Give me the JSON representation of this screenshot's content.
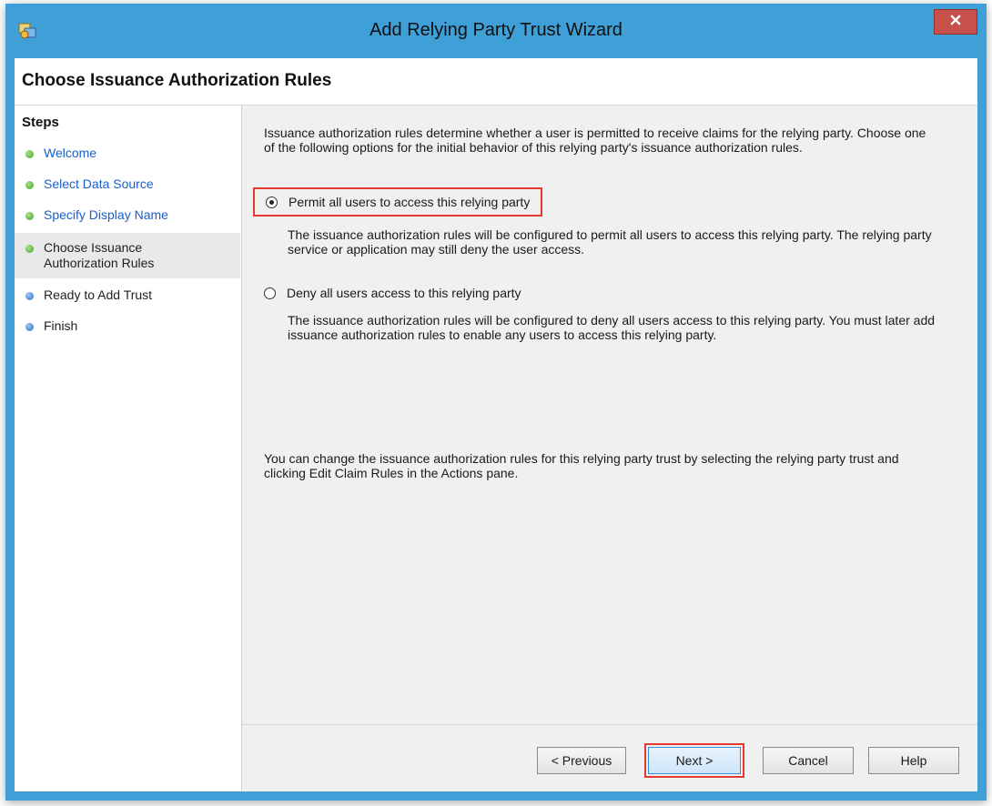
{
  "window": {
    "title": "Add Relying Party Trust Wizard"
  },
  "header": {
    "title": "Choose Issuance Authorization Rules"
  },
  "steps": {
    "heading": "Steps",
    "items": [
      {
        "label": "Welcome",
        "state": "done"
      },
      {
        "label": "Select Data Source",
        "state": "done"
      },
      {
        "label": "Specify Display Name",
        "state": "done"
      },
      {
        "label": "Choose Issuance Authorization Rules",
        "state": "current"
      },
      {
        "label": "Ready to Add Trust",
        "state": "pending"
      },
      {
        "label": "Finish",
        "state": "pending"
      }
    ]
  },
  "main": {
    "intro": "Issuance authorization rules determine whether a user is permitted to receive claims for the relying party. Choose one of the following options for the initial behavior of this relying party's issuance authorization rules.",
    "options": [
      {
        "label": "Permit all users to access this relying party",
        "selected": true,
        "description": "The issuance authorization rules will be configured to permit all users to access this relying party. The relying party service or application may still deny the user access."
      },
      {
        "label": "Deny all users access to this relying party",
        "selected": false,
        "description": "The issuance authorization rules will be configured to deny all users access to this relying party. You must later add issuance authorization rules to enable any users to access this relying party."
      }
    ],
    "note": "You can change the issuance authorization rules for this relying party trust by selecting the relying party trust and clicking Edit Claim Rules in the Actions pane."
  },
  "buttons": {
    "previous": "< Previous",
    "next": "Next >",
    "cancel": "Cancel",
    "help": "Help"
  },
  "colors": {
    "titlebar": "#3fa0d8",
    "close_button": "#c7504a",
    "highlight": "#e53a2f",
    "step_done": "#3fa42a",
    "step_pending": "#2d6fc9",
    "link": "#1a5fc9"
  },
  "icons": {
    "app": "adfs-wizard-icon",
    "close": "close-icon"
  }
}
